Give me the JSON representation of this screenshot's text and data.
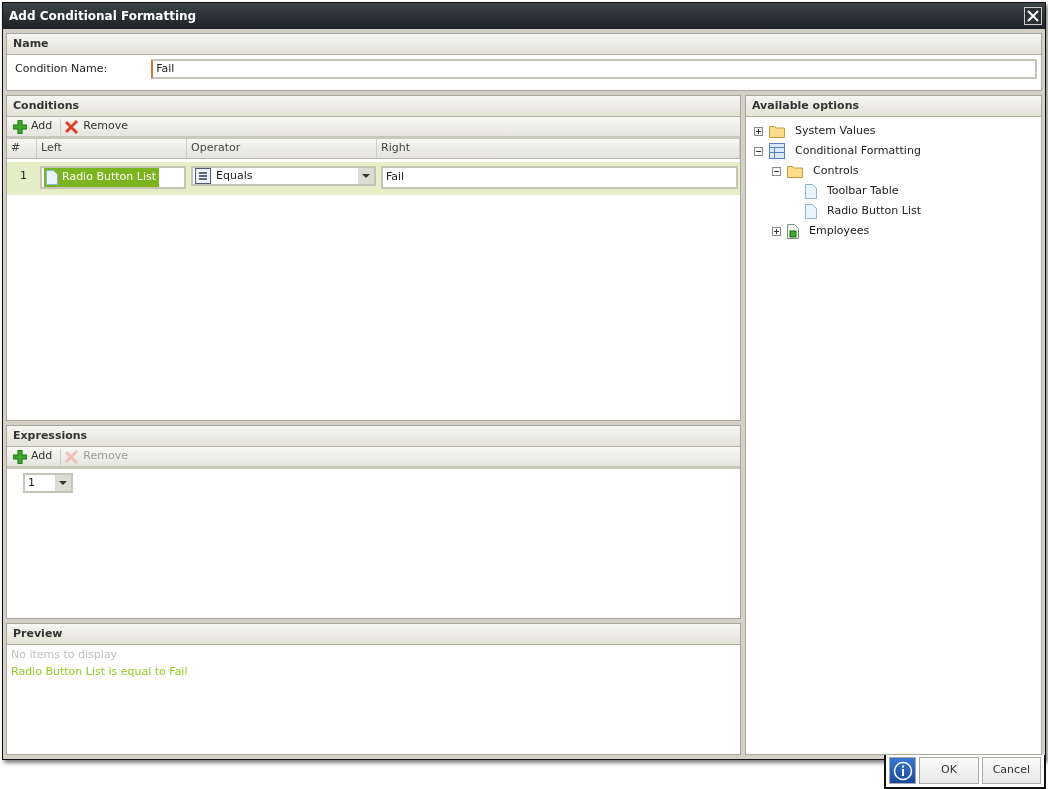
{
  "window": {
    "title": "Add Conditional Formatting"
  },
  "name_section": {
    "title": "Name",
    "label": "Condition Name:",
    "value": "Fail"
  },
  "conditions": {
    "title": "Conditions",
    "toolbar": [
      {
        "kind": "add",
        "label": "Add",
        "disabled": false
      },
      {
        "kind": "remove",
        "label": "Remove",
        "disabled": false
      }
    ],
    "columns": [
      "#",
      "Left",
      "Operator",
      "Right"
    ],
    "rows": [
      {
        "index": "1",
        "left": "Radio Button List",
        "left_highlighted": true,
        "operator": "Equals",
        "right": "Fail",
        "selected": true
      }
    ]
  },
  "expressions": {
    "title": "Expressions",
    "toolbar": [
      {
        "kind": "add",
        "label": "Add",
        "disabled": false
      },
      {
        "kind": "remove",
        "label": "Remove",
        "disabled": true
      }
    ],
    "selector": "1"
  },
  "preview": {
    "title": "Preview",
    "empty_text": "No items to display",
    "lines": [
      "Radio Button List is equal to Fail"
    ]
  },
  "options": {
    "title": "Available options",
    "tree": [
      {
        "label": "System Values",
        "kind": "folder",
        "expanded": false
      },
      {
        "label": "Conditional Formatting",
        "kind": "table",
        "expanded": true,
        "children": [
          {
            "label": "Controls",
            "kind": "folder",
            "expanded": true,
            "children": [
              {
                "label": "Toolbar Table",
                "kind": "document"
              },
              {
                "label": "Radio Button List",
                "kind": "document"
              }
            ]
          },
          {
            "label": "Employees",
            "kind": "data",
            "expanded": false
          }
        ]
      }
    ]
  },
  "buttons": [
    {
      "kind": "info"
    },
    {
      "kind": "text",
      "label": "OK"
    },
    {
      "kind": "text",
      "label": "Cancel"
    }
  ]
}
